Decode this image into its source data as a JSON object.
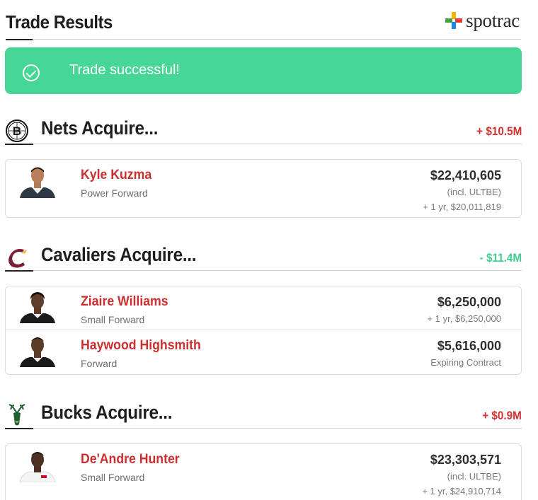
{
  "header": {
    "title": "Trade Results",
    "logo_text": "spotrac"
  },
  "banner": {
    "message": "Trade successful!",
    "color": "#46d696"
  },
  "sections": [
    {
      "title": "Nets Acquire...",
      "team_icon": "nets-logo",
      "cap_change": "+ $10.5M",
      "cap_change_color": "#d23232",
      "players": [
        {
          "name": "Kyle Kuzma",
          "position": "Power Forward",
          "salary": "$22,410,605",
          "detail1": "(incl. ULTBE)",
          "detail2": "+ 1 yr, $20,011,819"
        }
      ]
    },
    {
      "title": "Cavaliers Acquire...",
      "team_icon": "cavaliers-logo",
      "cap_change": "- $11.4M",
      "cap_change_color": "#3fcf8e",
      "players": [
        {
          "name": "Ziaire Williams",
          "position": "Small Forward",
          "salary": "$6,250,000",
          "detail1": "+ 1 yr, $6,250,000"
        },
        {
          "name": "Haywood Highsmith",
          "position": "Forward",
          "salary": "$5,616,000",
          "detail1": "Expiring Contract"
        }
      ]
    },
    {
      "title": "Bucks Acquire...",
      "team_icon": "bucks-logo",
      "cap_change": "+ $0.9M",
      "cap_change_color": "#d23232",
      "players": [
        {
          "name": "De'Andre Hunter",
          "position": "Small Forward",
          "salary": "$23,303,571",
          "detail1": "(incl. ULTBE)",
          "detail2": "+ 1 yr, $24,910,714"
        }
      ]
    }
  ]
}
